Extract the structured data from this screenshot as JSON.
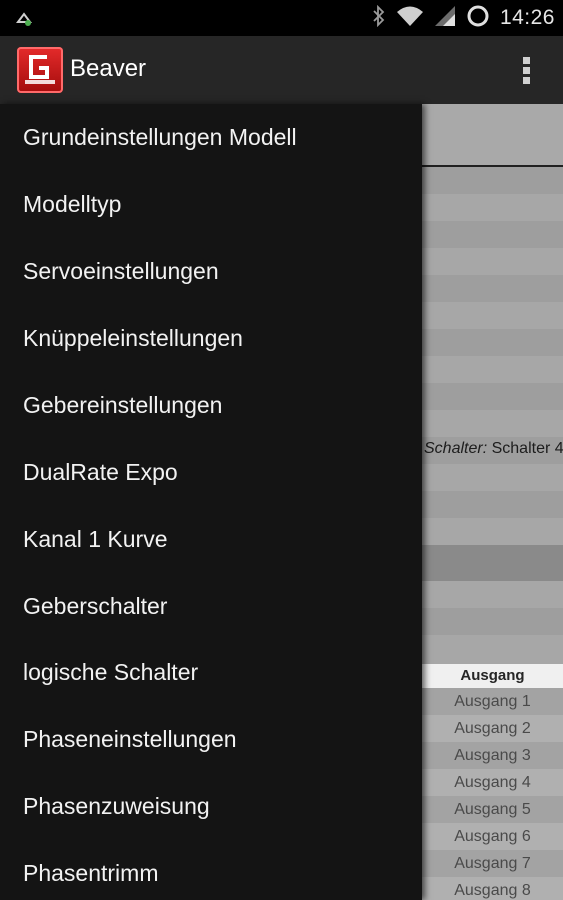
{
  "status_bar": {
    "time": "14:26",
    "icons": [
      "notification-icon",
      "bluetooth-icon",
      "wifi-icon",
      "signal-icon",
      "battery-icon"
    ]
  },
  "action_bar": {
    "title": "Beaver",
    "logo_text": "GRAUPNER",
    "menu_icon": "overflow-menu-icon"
  },
  "drawer": {
    "items": [
      "Grundeinstellungen Modell",
      "Modelltyp",
      "Servoeinstellungen",
      "Knüppeleinstellungen",
      "Gebereinstellungen",
      "DualRate Expo",
      "Kanal 1 Kurve",
      "Geberschalter",
      "logische Schalter",
      "Phaseneinstellungen",
      "Phasenzuweisung",
      "Phasentrimm"
    ]
  },
  "content": {
    "schalter_label": "Schalter:",
    "schalter_value": "Schalter 4",
    "table_header": "Ausgang",
    "outputs": [
      "Ausgang 1",
      "Ausgang 2",
      "Ausgang 3",
      "Ausgang 4",
      "Ausgang 5",
      "Ausgang 6",
      "Ausgang 7",
      "Ausgang 8"
    ]
  },
  "colors": {
    "drawer_bg": "#141414",
    "action_bar_bg": "#262626",
    "logo_red": "#d81f1f"
  }
}
